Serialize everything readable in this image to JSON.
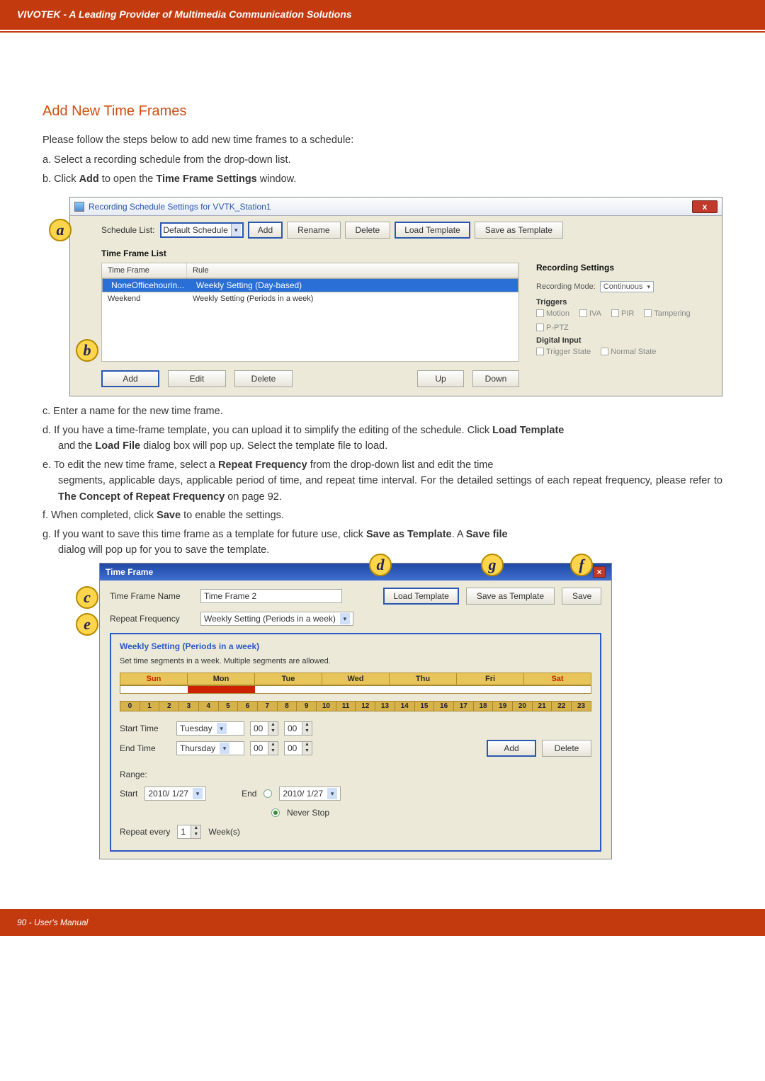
{
  "header": "VIVOTEK - A Leading Provider of Multimedia Communication Solutions",
  "section_title": "Add New Time Frames",
  "intro": "Please follow the steps below to add new time frames to a schedule:",
  "step_a": "a. Select a recording schedule from the drop-down list.",
  "step_b_pre": "b. Click ",
  "step_b_bold1": "Add",
  "step_b_mid": " to open the ",
  "step_b_bold2": "Time Frame Settings",
  "step_b_post": " window.",
  "shot1": {
    "title": "Recording Schedule Settings for VVTK_Station1",
    "close": "x",
    "schedule_list_label": "Schedule List:",
    "schedule_value": "Default Schedule",
    "btn_add": "Add",
    "btn_rename": "Rename",
    "btn_delete": "Delete",
    "btn_load": "Load Template",
    "btn_saveas": "Save as Template",
    "frame_list": "Time Frame List",
    "th_tf": "Time Frame",
    "th_rule": "Rule",
    "row1_tf": "NoneOfficehourin...",
    "row1_rule": "Weekly Setting (Day-based)",
    "row2_tf": "Weekend",
    "row2_rule": "Weekly Setting (Periods in a week)",
    "btn2_add": "Add",
    "btn2_edit": "Edit",
    "btn2_delete": "Delete",
    "btn2_up": "Up",
    "btn2_down": "Down",
    "rec_title": "Recording Settings",
    "rec_mode_l": "Recording Mode:",
    "rec_mode_v": "Continuous",
    "triggers": "Triggers",
    "t_motion": "Motion",
    "t_iva": "IVA",
    "t_pir": "PIR",
    "t_tamp": "Tampering",
    "t_pptz": "P-PTZ",
    "di": "Digital Input",
    "di_ts": "Trigger State",
    "di_ns": "Normal State"
  },
  "step_c": "c. Enter a name for the new time frame.",
  "step_d": "d. If you have a time-frame template, you can upload it to simplify the editing of the schedule. Click Load Template and the Load File dialog box will pop up. Select the template file to load.",
  "step_d_bold1": "Load Template",
  "step_d_bold2": "Load File",
  "step_e": "e. To edit the new time frame, select a Repeat Frequency from the drop-down list and edit the time segments, applicable days, applicable period of time, and repeat time interval. For the detailed settings of each repeat frequency, please refer to The Concept of Repeat Frequency on page 92.",
  "step_e_bold1": "Repeat Frequency",
  "step_e_bold2": "The Concept of Repeat Frequency",
  "step_f_pre": "f. When completed, click ",
  "step_f_bold": "Save",
  "step_f_post": " to enable the settings.",
  "step_g": "g. If you want to save this time frame as a template for future use, click Save as Template. A Save file dialog will pop up for you to save the template.",
  "step_g_bold1": "Save as Template",
  "step_g_bold2": "Save file",
  "shot2": {
    "title": "Time Frame",
    "name_l": "Time Frame Name",
    "name_v": "Time Frame 2",
    "btn_load": "Load Template",
    "btn_saveas": "Save as Template",
    "btn_save": "Save",
    "rf_l": "Repeat Frequency",
    "rf_v": "Weekly Setting (Periods in a week)",
    "panel_title": "Weekly Setting (Periods in a week)",
    "panel_desc": "Set time segments in a week. Multiple segments are allowed.",
    "days": [
      "Sun",
      "Mon",
      "Tue",
      "Wed",
      "Thu",
      "Fri",
      "Sat"
    ],
    "hours": [
      "0",
      "1",
      "2",
      "3",
      "4",
      "5",
      "6",
      "7",
      "8",
      "9",
      "10",
      "11",
      "12",
      "13",
      "14",
      "15",
      "16",
      "17",
      "18",
      "19",
      "20",
      "21",
      "22",
      "23"
    ],
    "st_l": "Start Time",
    "st_day": "Tuesday",
    "st_h": "00",
    "st_m": "00",
    "et_l": "End Time",
    "et_day": "Thursday",
    "et_h": "00",
    "et_m": "00",
    "btn_add": "Add",
    "btn_del": "Delete",
    "range": "Range:",
    "start": "Start",
    "end": "End",
    "start_v": "2010/ 1/27",
    "end_v": "2010/ 1/27",
    "never": "Never Stop",
    "rep_l": "Repeat every",
    "rep_v": "1",
    "rep_unit": "Week(s)"
  },
  "bub": {
    "a": "a",
    "b": "b",
    "c": "c",
    "d": "d",
    "e": "e",
    "f": "f",
    "g": "g"
  },
  "footer": "90 - User's Manual"
}
